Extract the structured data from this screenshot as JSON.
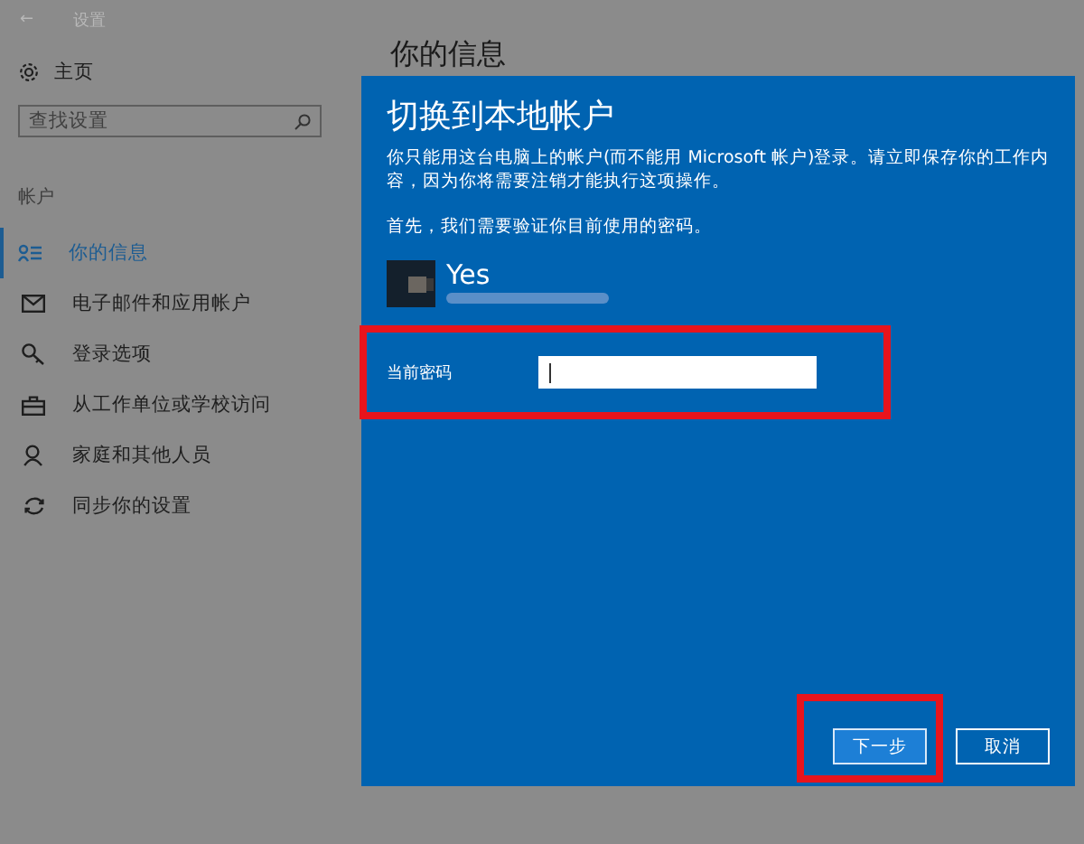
{
  "window": {
    "back": "←",
    "title": "设置"
  },
  "sidebar": {
    "home": "主页",
    "search": {
      "placeholder": "查找设置"
    },
    "section": "帐户",
    "items": [
      {
        "label": "你的信息",
        "selected": true
      },
      {
        "label": "电子邮件和应用帐户",
        "selected": false
      },
      {
        "label": "登录选项",
        "selected": false
      },
      {
        "label": "从工作单位或学校访问",
        "selected": false
      },
      {
        "label": "家庭和其他人员",
        "selected": false
      },
      {
        "label": "同步你的设置",
        "selected": false
      }
    ]
  },
  "page": {
    "heading": "你的信息"
  },
  "dialog": {
    "title": "切换到本地帐户",
    "message": "你只能用这台电脑上的帐户(而不能用 Microsoft 帐户)登录。请立即保存你的工作内容，因为你将需要注销才能执行这项操作。",
    "prompt": "首先，我们需要验证你目前使用的密码。",
    "account": {
      "name": "Yes"
    },
    "field": {
      "label": "当前密码",
      "highlighted": true
    },
    "buttons": [
      {
        "label": "下一步",
        "kind": "primary",
        "highlighted": true
      },
      {
        "label": "取消",
        "kind": "secondary",
        "highlighted": false
      }
    ]
  }
}
